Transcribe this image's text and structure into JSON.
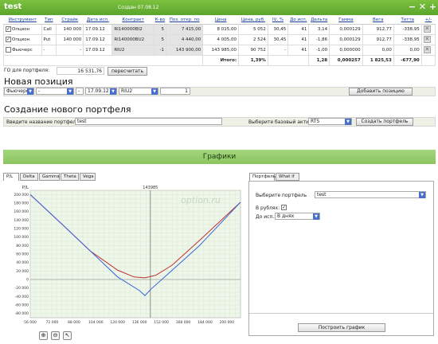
{
  "window": {
    "title": "test",
    "created": "Создан 07.08.12",
    "minimize": "−",
    "close": "✕",
    "add": "+"
  },
  "table": {
    "headers": [
      "Инструмент",
      "Тип",
      "Страйк",
      "Дата исп.",
      "Контракт",
      "К-во",
      "Поз. откр. по",
      "Цена",
      "Цена, руб.",
      "IV, %",
      "До исп.",
      "Дельта",
      "Гамма",
      "Вега",
      "Тетта",
      "+/-"
    ],
    "rows": [
      {
        "instrument": "Опцион",
        "type": "Call",
        "strike": "140 000",
        "date": "17.09.12",
        "contract": "RI140000BI2",
        "qty": "5",
        "open": "7 415,00",
        "price": "8 015,00",
        "price_rub": "5 052",
        "iv": "30,45",
        "days": "41",
        "delta": "3,14",
        "gamma": "0,000129",
        "vega": "912,77",
        "theta": "-338,95"
      },
      {
        "instrument": "Опцион",
        "type": "Put",
        "strike": "140 000",
        "date": "17.09.12",
        "contract": "RI140000BU2",
        "qty": "5",
        "open": "4 440,00",
        "price": "4 005,00",
        "price_rub": "2 524",
        "iv": "30,45",
        "days": "41",
        "delta": "-1,86",
        "gamma": "0,000129",
        "vega": "912,77",
        "theta": "-338,95"
      },
      {
        "instrument": "Фьючерс",
        "type": "-",
        "strike": "-",
        "date": "17.09.12",
        "contract": "RIU2",
        "qty": "-1",
        "open": "143 900,00",
        "price": "143 985,00",
        "price_rub": "90 752",
        "iv": "-",
        "days": "41",
        "delta": "-1,00",
        "gamma": "0,000000",
        "vega": "0,00",
        "theta": "0,00"
      }
    ],
    "total_label": "Итого:",
    "total_pct": "1,39%",
    "totals": {
      "delta": "1,28",
      "gamma": "0,000257",
      "vega": "1 825,53",
      "theta": "-677,90"
    }
  },
  "go": {
    "label": "ГО для портфеля:",
    "value": "16 531,76",
    "recalc": "пересчитать"
  },
  "new_position": {
    "title": "Новая позиция",
    "instrument": "Фьючерс",
    "type": "-",
    "strike": "-",
    "date": "17.09.12",
    "contract": "RIU2",
    "qty": "1",
    "add_button": "Добавить позицию"
  },
  "new_portfolio": {
    "title": "Создание нового портфеля",
    "name_label": "Введите название портфеля",
    "name_value": "test",
    "asset_label": "Выберите базовый актив",
    "asset_value": "RTS",
    "create_button": "Создать портфель"
  },
  "charts": {
    "title": "Графики",
    "tabs": [
      "P/L",
      "Delta",
      "Gamma",
      "Theta",
      "Vega"
    ],
    "right_tabs": [
      "Портфель",
      "What if"
    ],
    "select_portfolio_label": "Выберите портфель",
    "select_portfolio_value": "test",
    "rub_label": "В рублях:",
    "expiry_label": "До исп.:",
    "expiry_value": "В днях",
    "build_button": "Построить график",
    "watermark": "option.ru"
  },
  "chart_data": {
    "type": "line",
    "ylabel": "P/L",
    "marker_label": "143985",
    "marker_x": 143985,
    "xlim": [
      56000,
      210000
    ],
    "ylim": [
      -100,
      220000
    ],
    "x_ticks": [
      "56 000",
      "72 000",
      "88 000",
      "104 000",
      "120 000",
      "136 000",
      "152 000",
      "168 000",
      "184 000",
      "200 000"
    ],
    "y_ticks": [
      "200 000",
      "180 000",
      "160 000",
      "140 000",
      "120 000",
      "100 000",
      "80 000",
      "60 000",
      "40 000",
      "20 000",
      "0",
      "-20 000",
      "-40 000",
      "-60 000",
      "-80 000"
    ],
    "series": [
      {
        "color": "#c03030",
        "x": [
          56000,
          80000,
          100000,
          120000,
          132000,
          140000,
          148000,
          160000,
          180000,
          210000
        ],
        "y": [
          200000,
          128000,
          67000,
          22000,
          6000,
          4000,
          10000,
          34000,
          92000,
          182000
        ]
      },
      {
        "color": "#3a64d8",
        "x": [
          56000,
          80000,
          100000,
          120000,
          136000,
          140000,
          144000,
          160000,
          180000,
          210000
        ],
        "y": [
          200000,
          128000,
          67000,
          6000,
          -26000,
          -38000,
          -24000,
          22000,
          80000,
          182000
        ]
      }
    ]
  }
}
